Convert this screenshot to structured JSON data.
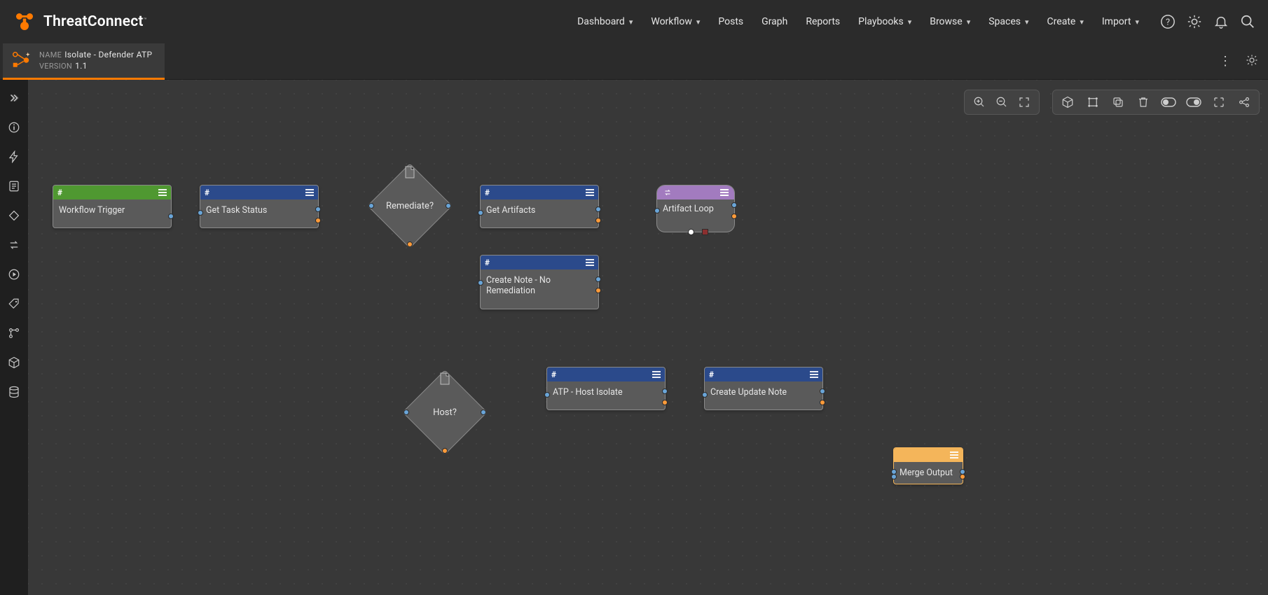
{
  "brand": {
    "name": "ThreatConnect",
    "tm": "™"
  },
  "nav": {
    "items": [
      {
        "label": "Dashboard",
        "dropdown": true
      },
      {
        "label": "Workflow",
        "dropdown": true
      },
      {
        "label": "Posts",
        "dropdown": false
      },
      {
        "label": "Graph",
        "dropdown": false
      },
      {
        "label": "Reports",
        "dropdown": false
      },
      {
        "label": "Playbooks",
        "dropdown": true
      },
      {
        "label": "Browse",
        "dropdown": true
      },
      {
        "label": "Spaces",
        "dropdown": true
      },
      {
        "label": "Create",
        "dropdown": true
      },
      {
        "label": "Import",
        "dropdown": true
      }
    ]
  },
  "playbook": {
    "name_label": "NAME",
    "name": "Isolate - Defender ATP",
    "version_label": "VERSION",
    "version": "1.1"
  },
  "nodes": {
    "trigger": {
      "title": "Workflow Trigger"
    },
    "get_task": {
      "title": "Get Task Status"
    },
    "remediate": {
      "title": "Remediate?"
    },
    "get_artifacts": {
      "title": "Get Artifacts"
    },
    "create_note": {
      "title": "Create Note - No Remediation"
    },
    "artifact_loop": {
      "title": "Artifact Loop"
    },
    "host": {
      "title": "Host?"
    },
    "atp_isolate": {
      "title": "ATP - Host Isolate"
    },
    "update_note": {
      "title": "Create Update Note"
    },
    "merge": {
      "title": "Merge Output"
    }
  },
  "sidebar_icons": [
    "expand-icon",
    "info-icon",
    "bolt-icon",
    "form-icon",
    "diamond-icon",
    "loop-icon",
    "play-icon",
    "tag-icon",
    "branch-icon",
    "cube-icon",
    "db-icon"
  ],
  "toolbar": {
    "zoom_in": "zoom-in",
    "zoom_out": "zoom-out",
    "fit": "fit",
    "cube": "cube",
    "align": "align",
    "copy": "copy",
    "trash": "trash",
    "toggle1": "toggle-view-1",
    "toggle2": "toggle-view-2",
    "full": "fullscreen",
    "share": "share"
  }
}
